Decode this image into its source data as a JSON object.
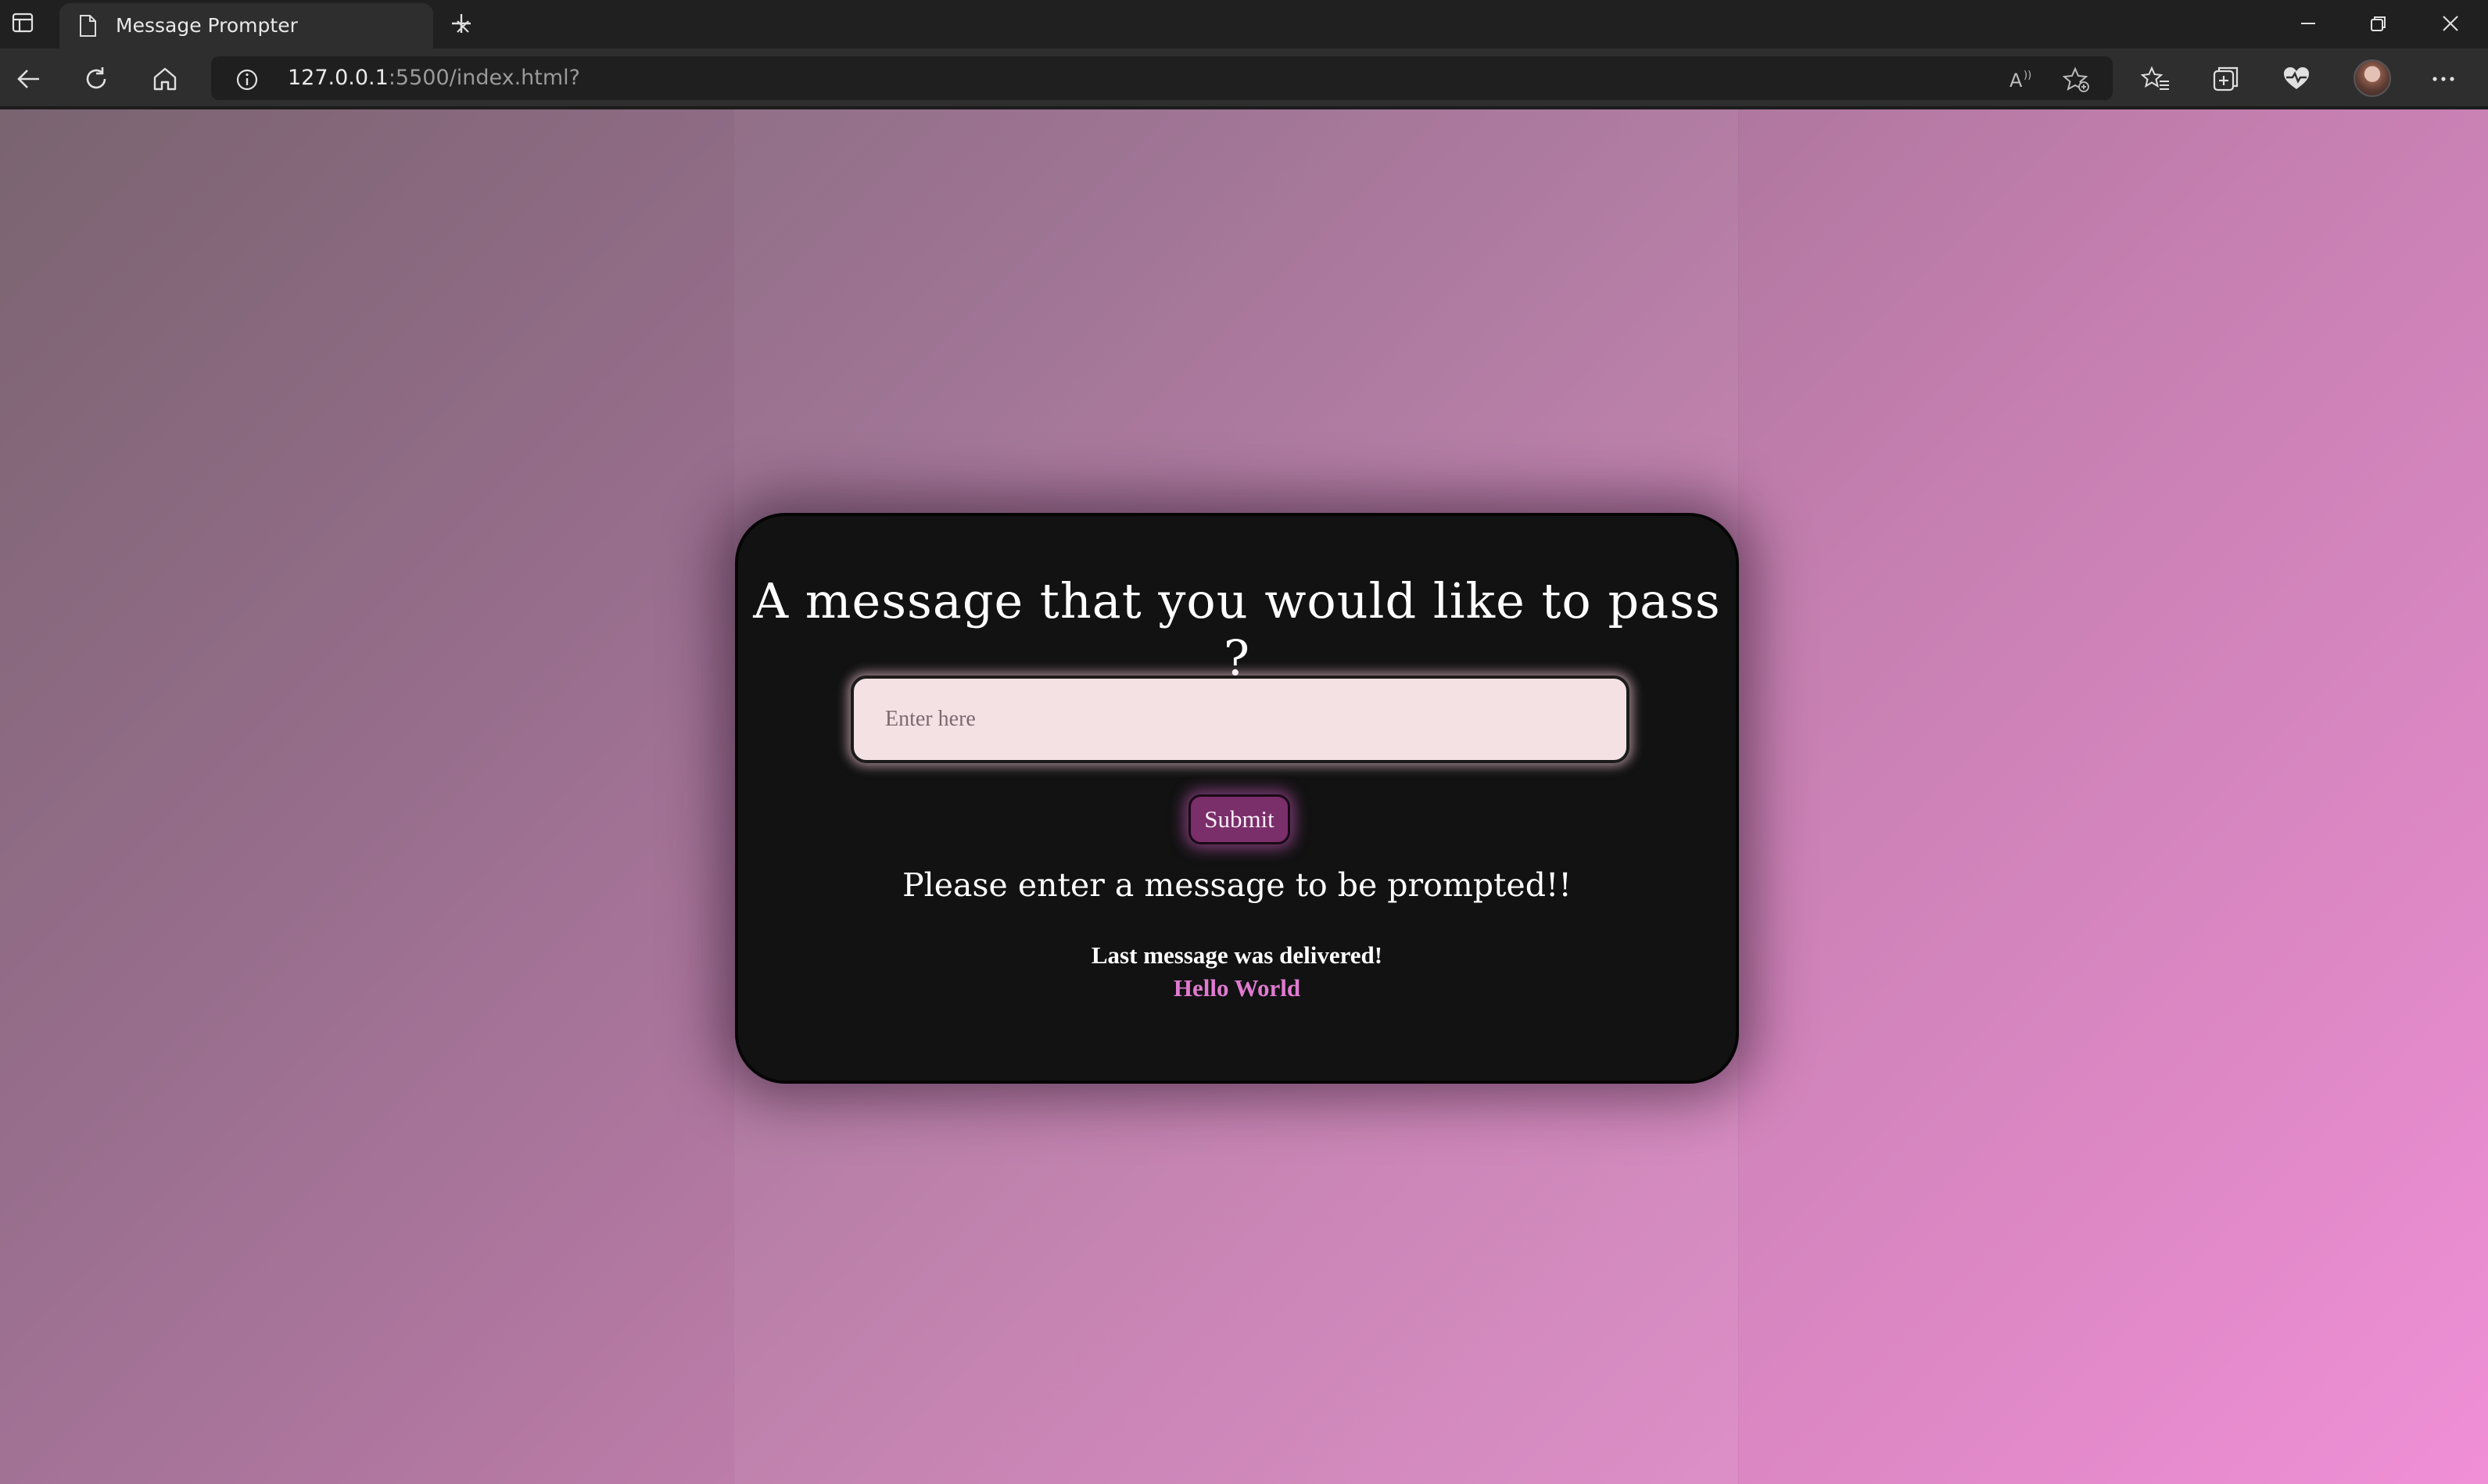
{
  "browser": {
    "tab_title": "Message Prompter",
    "url_host": "127.0.0.1",
    "url_rest": ":5500/index.html?"
  },
  "page": {
    "heading": "A message that you would like to pass ?",
    "input_placeholder": "Enter here",
    "input_value": "",
    "submit_label": "Submit",
    "status_message": "Please enter a message to be prompted!!",
    "last_message_label": "Last message was delivered!",
    "last_message_value": "Hello World"
  },
  "colors": {
    "card_background": "#121212",
    "submit_background": "#7a2e6a",
    "last_message_color": "#e07ad0",
    "input_background": "#f3e1e4"
  },
  "icons": {
    "tab_sidebar": "tab-sidebar-icon",
    "page": "page-icon",
    "close": "close-icon",
    "new_tab": "plus-icon",
    "back": "back-arrow-icon",
    "refresh": "refresh-icon",
    "home": "home-icon",
    "info": "info-icon",
    "read_aloud": "read-aloud-icon",
    "add_favorite": "add-favorite-icon",
    "favorites": "favorites-icon",
    "collections": "collections-icon",
    "health": "browser-essentials-icon",
    "more": "more-icon"
  }
}
